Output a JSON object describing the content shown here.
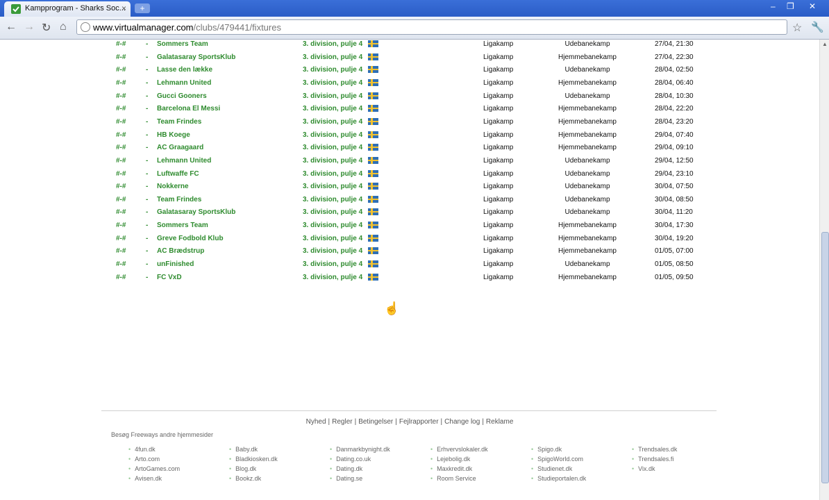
{
  "browser": {
    "tab_title": "Kampprogram - Sharks Soc...",
    "url_host": "www.virtualmanager.com",
    "url_path": "/clubs/479441/fixtures"
  },
  "fixtures": [
    {
      "score": "#-#",
      "dash": "-",
      "team": "Sommers Team",
      "comp": "3. division, pulje 4",
      "type": "Ligakamp",
      "venue": "Udebanekamp",
      "date": "27/04, 21:30"
    },
    {
      "score": "#-#",
      "dash": "-",
      "team": "Galatasaray SportsKlub",
      "comp": "3. division, pulje 4",
      "type": "Ligakamp",
      "venue": "Hjemmebanekamp",
      "date": "27/04, 22:30"
    },
    {
      "score": "#-#",
      "dash": "-",
      "team": "Lasse den lække",
      "comp": "3. division, pulje 4",
      "type": "Ligakamp",
      "venue": "Udebanekamp",
      "date": "28/04, 02:50"
    },
    {
      "score": "#-#",
      "dash": "-",
      "team": "Lehmann United",
      "comp": "3. division, pulje 4",
      "type": "Ligakamp",
      "venue": "Hjemmebanekamp",
      "date": "28/04, 06:40"
    },
    {
      "score": "#-#",
      "dash": "-",
      "team": "Gucci Gooners",
      "comp": "3. division, pulje 4",
      "type": "Ligakamp",
      "venue": "Udebanekamp",
      "date": "28/04, 10:30"
    },
    {
      "score": "#-#",
      "dash": "-",
      "team": "Barcelona El Messi",
      "comp": "3. division, pulje 4",
      "type": "Ligakamp",
      "venue": "Hjemmebanekamp",
      "date": "28/04, 22:20"
    },
    {
      "score": "#-#",
      "dash": "-",
      "team": "Team Frindes",
      "comp": "3. division, pulje 4",
      "type": "Ligakamp",
      "venue": "Hjemmebanekamp",
      "date": "28/04, 23:20"
    },
    {
      "score": "#-#",
      "dash": "-",
      "team": "HB Koege",
      "comp": "3. division, pulje 4",
      "type": "Ligakamp",
      "venue": "Hjemmebanekamp",
      "date": "29/04, 07:40"
    },
    {
      "score": "#-#",
      "dash": "-",
      "team": "AC Graagaard",
      "comp": "3. division, pulje 4",
      "type": "Ligakamp",
      "venue": "Hjemmebanekamp",
      "date": "29/04, 09:10"
    },
    {
      "score": "#-#",
      "dash": "-",
      "team": "Lehmann United",
      "comp": "3. division, pulje 4",
      "type": "Ligakamp",
      "venue": "Udebanekamp",
      "date": "29/04, 12:50"
    },
    {
      "score": "#-#",
      "dash": "-",
      "team": "Luftwaffe FC",
      "comp": "3. division, pulje 4",
      "type": "Ligakamp",
      "venue": "Udebanekamp",
      "date": "29/04, 23:10"
    },
    {
      "score": "#-#",
      "dash": "-",
      "team": "Nokkerne",
      "comp": "3. division, pulje 4",
      "type": "Ligakamp",
      "venue": "Udebanekamp",
      "date": "30/04, 07:50"
    },
    {
      "score": "#-#",
      "dash": "-",
      "team": "Team Frindes",
      "comp": "3. division, pulje 4",
      "type": "Ligakamp",
      "venue": "Udebanekamp",
      "date": "30/04, 08:50"
    },
    {
      "score": "#-#",
      "dash": "-",
      "team": "Galatasaray SportsKlub",
      "comp": "3. division, pulje 4",
      "type": "Ligakamp",
      "venue": "Udebanekamp",
      "date": "30/04, 11:20"
    },
    {
      "score": "#-#",
      "dash": "-",
      "team": "Sommers Team",
      "comp": "3. division, pulje 4",
      "type": "Ligakamp",
      "venue": "Hjemmebanekamp",
      "date": "30/04, 17:30"
    },
    {
      "score": "#-#",
      "dash": "-",
      "team": "Greve Fodbold Klub",
      "comp": "3. division, pulje 4",
      "type": "Ligakamp",
      "venue": "Hjemmebanekamp",
      "date": "30/04, 19:20"
    },
    {
      "score": "#-#",
      "dash": "-",
      "team": "AC Brædstrup",
      "comp": "3. division, pulje 4",
      "type": "Ligakamp",
      "venue": "Hjemmebanekamp",
      "date": "01/05, 07:00"
    },
    {
      "score": "#-#",
      "dash": "-",
      "team": "unFinished",
      "comp": "3. division, pulje 4",
      "type": "Ligakamp",
      "venue": "Udebanekamp",
      "date": "01/05, 08:50"
    },
    {
      "score": "#-#",
      "dash": "-",
      "team": "FC VxD",
      "comp": "3. division, pulje 4",
      "type": "Ligakamp",
      "venue": "Hjemmebanekamp",
      "date": "01/05, 09:50"
    }
  ],
  "footer": {
    "links": [
      "Nyhed",
      "Regler",
      "Betingelser",
      "Fejlrapporter",
      "Change log",
      "Reklame"
    ],
    "separator": "|",
    "other_sites_label": "Besøg Freeways andre hjemmesider",
    "site_columns": [
      [
        "4fun.dk",
        "Arto.com",
        "ArtoGames.com",
        "Avisen.dk"
      ],
      [
        "Baby.dk",
        "Bladkiosken.dk",
        "Blog.dk",
        "Bookz.dk"
      ],
      [
        "Danmarkbynight.dk",
        "Dating.co.uk",
        "Dating.dk",
        "Dating.se"
      ],
      [
        "Erhvervslokaler.dk",
        "Lejebolig.dk",
        "Maxkredit.dk",
        "Room Service"
      ],
      [
        "Spigo.dk",
        "SpigoWorld.com",
        "Studienet.dk",
        "Studieportalen.dk"
      ],
      [
        "Trendsales.dk",
        "Trendsales.fi",
        "Vix.dk"
      ]
    ]
  }
}
